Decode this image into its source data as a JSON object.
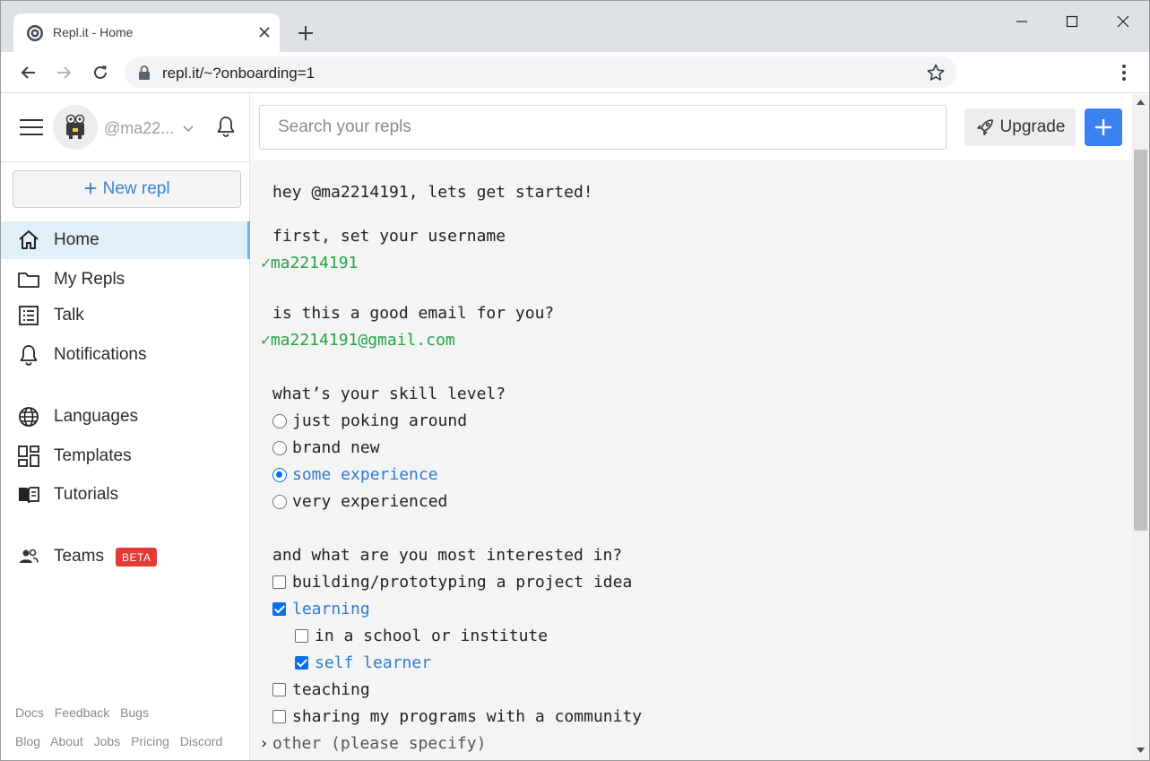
{
  "browser": {
    "tab_title": "Repl.it - Home",
    "url": "repl.it/~?onboarding=1"
  },
  "sidebar": {
    "username": "@ma22...",
    "new_repl_label": "New repl",
    "items": [
      {
        "label": "Home",
        "icon": "home-icon",
        "active": true
      },
      {
        "label": "My Repls",
        "icon": "folder-icon"
      },
      {
        "label": "Talk",
        "icon": "list-icon"
      },
      {
        "label": "Notifications",
        "icon": "bell-icon"
      },
      {
        "label": "Languages",
        "icon": "globe-icon"
      },
      {
        "label": "Templates",
        "icon": "templates-icon"
      },
      {
        "label": "Tutorials",
        "icon": "book-icon"
      },
      {
        "label": "Teams",
        "icon": "people-icon",
        "badge": "BETA"
      }
    ],
    "footer_row1": [
      "Docs",
      "Feedback",
      "Bugs"
    ],
    "footer_row2": [
      "Blog",
      "About",
      "Jobs",
      "Pricing",
      "Discord"
    ]
  },
  "topbar": {
    "search_placeholder": "Search your repls",
    "upgrade_label": "Upgrade"
  },
  "onboarding": {
    "greeting": "hey @ma2214191, lets get started!",
    "username_prompt": "first, set your username",
    "username_value": "✓ma2214191",
    "email_prompt": "is this a good email for you?",
    "email_value": "✓ma2214191@gmail.com",
    "skill_prompt": "what’s your skill level?",
    "skill_options": [
      {
        "label": "just poking around",
        "selected": false
      },
      {
        "label": "brand new",
        "selected": false
      },
      {
        "label": "some experience",
        "selected": true
      },
      {
        "label": "very experienced",
        "selected": false
      }
    ],
    "interest_prompt": "and what are you most interested in?",
    "interest_options": [
      {
        "label": "building/prototyping a project idea",
        "checked": false
      },
      {
        "label": "learning",
        "checked": true
      },
      {
        "label": "in a school or institute",
        "checked": false
      },
      {
        "label": "self learner",
        "checked": true
      },
      {
        "label": "teaching",
        "checked": false
      },
      {
        "label": "sharing my programs with a community",
        "checked": false
      }
    ],
    "other_prefix": "›",
    "other_label": "other (please specify)"
  },
  "colors": {
    "accent_blue": "#3b82f0",
    "success_green": "#22a34b",
    "active_nav_bg": "#e1f0f8",
    "beta_red": "#e53935"
  }
}
